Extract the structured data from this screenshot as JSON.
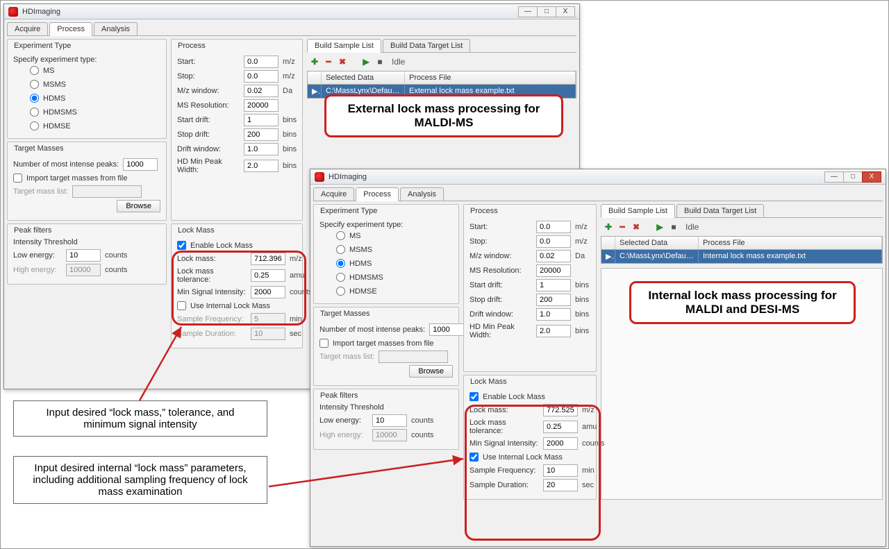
{
  "app": {
    "title": "HDImaging"
  },
  "winctl": {
    "min": "—",
    "max": "□",
    "close": "X"
  },
  "tabs": {
    "acquire": "Acquire",
    "process": "Process",
    "analysis": "Analysis"
  },
  "exp": {
    "legend": "Experiment Type",
    "label": "Specify experiment type:",
    "ms": "MS",
    "msms": "MSMS",
    "hdms": "HDMS",
    "hdmsms": "HDMSMS",
    "hdmse": "HDMSE"
  },
  "target": {
    "legend": "Target Masses",
    "numlabel": "Number of most intense peaks:",
    "numval": "1000",
    "import": "Import target masses from file",
    "listlabel": "Target mass list:",
    "browse": "Browse"
  },
  "peak": {
    "legend": "Peak filters",
    "sublabel": "Intensity Threshold",
    "low": "Low energy:",
    "lowv": "10",
    "high": "High energy:",
    "highv": "10000",
    "unit": "counts"
  },
  "proc": {
    "legend": "Process",
    "start": "Start:",
    "startv": "0.0",
    "mz": "m/z",
    "stop": "Stop:",
    "stopv": "0.0",
    "mzwin": "M/z window:",
    "mzwinv": "0.02",
    "da": "Da",
    "msres": "MS Resolution:",
    "msresv": "20000",
    "startdrift": "Start drift:",
    "startdriftv": "1",
    "bins": "bins",
    "stopdrift": "Stop drift:",
    "stopdriftv": "200",
    "driftwin": "Drift window:",
    "driftwinv": "1.0",
    "hdmin": "HD Min Peak Width:",
    "hdminv": "2.0"
  },
  "lockA": {
    "legend": "Lock Mass",
    "enable": "Enable Lock Mass",
    "lm": "Lock mass:",
    "lmv": "712.3965",
    "tol": "Lock mass tolerance:",
    "tolv": "0.25",
    "amu": "amu",
    "min": "Min Signal Intensity:",
    "minv": "2000",
    "useint": "Use Internal Lock Mass",
    "sfreq": "Sample Frequency:",
    "sfreqv": "5",
    "minu": "min",
    "sdur": "Sample Duration:",
    "sdurv": "10",
    "sec": "sec"
  },
  "lockB": {
    "lmv": "772.5254",
    "sfreqv": "10",
    "sdurv": "20"
  },
  "subtabs": {
    "build": "Build Sample List",
    "target": "Build Data Target List"
  },
  "tb": {
    "idle": "Idle"
  },
  "gridA": {
    "h0": "",
    "h1": "Selected Data",
    "h2": "Process File",
    "c1": "C:\\MassLynx\\Default...",
    "c2": "External lock mass example.txt"
  },
  "gridB": {
    "c1": "C:\\MassLynx\\Default...",
    "c2": "Internal lock mass example.txt"
  },
  "callouts": {
    "ext": "External lock mass processing for MALDI-MS",
    "int": "Internal lock mass processing for MALDI and DESI-MS"
  },
  "ann": {
    "a1": "Input desired “lock mass,” tolerance, and minimum signal intensity",
    "a2": "Input desired internal “lock mass” parameters, including additional sampling frequency of lock mass examination"
  },
  "icons": {
    "arrow": "▶"
  }
}
